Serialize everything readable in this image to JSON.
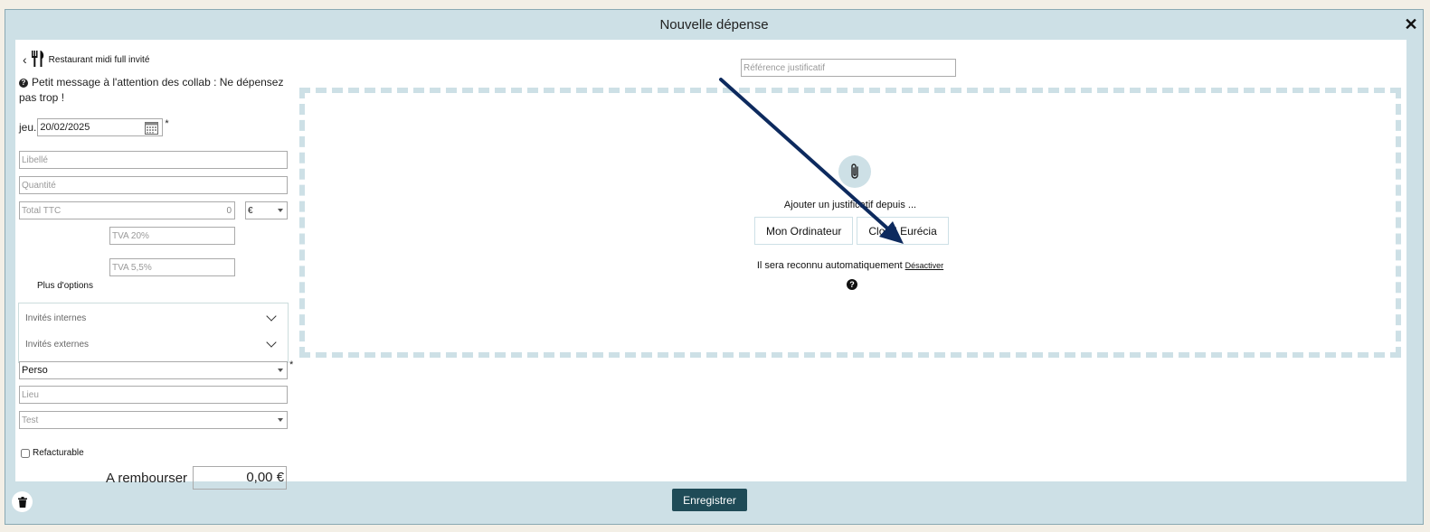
{
  "modal": {
    "title": "Nouvelle dépense",
    "close_label": "✕"
  },
  "back": {
    "label": "Restaurant midi full invité"
  },
  "message": "Petit message à l'attention des collab : Ne dépensez pas trop !",
  "date": {
    "prefix": "jeu.",
    "value": "20/02/2025",
    "required": "*"
  },
  "fields": {
    "libelle_placeholder": "Libellé",
    "quantite_placeholder": "Quantité",
    "total_ttc_placeholder": "Total TTC",
    "total_ttc_value": "0",
    "currency": "€",
    "tva20_placeholder": "TVA 20%",
    "tva55_placeholder": "TVA 5,5%",
    "lieu_placeholder": "Lieu"
  },
  "plus_options": "Plus d'options",
  "guests": {
    "internes": "Invités internes",
    "externes": "Invités externes"
  },
  "perso": {
    "value": "Perso",
    "required": "*"
  },
  "test_select": {
    "value": "Test"
  },
  "refacturable": "Refacturable",
  "rembourser": {
    "label": "A rembourser",
    "value": "0,00 €"
  },
  "reference_placeholder": "Référence justificatif",
  "dropzone": {
    "prompt": "Ajouter un justificatif depuis ...",
    "btn_computer": "Mon Ordinateur",
    "btn_cloud": "Cloud Eurécia",
    "auto_text": "Il sera reconnu automatiquement",
    "deactivate": "Désactiver"
  },
  "footer": {
    "save_label": "Enregistrer"
  },
  "colors": {
    "frame": "#cde0e6",
    "save": "#1f4b57",
    "arrow": "#0d2a5e"
  }
}
